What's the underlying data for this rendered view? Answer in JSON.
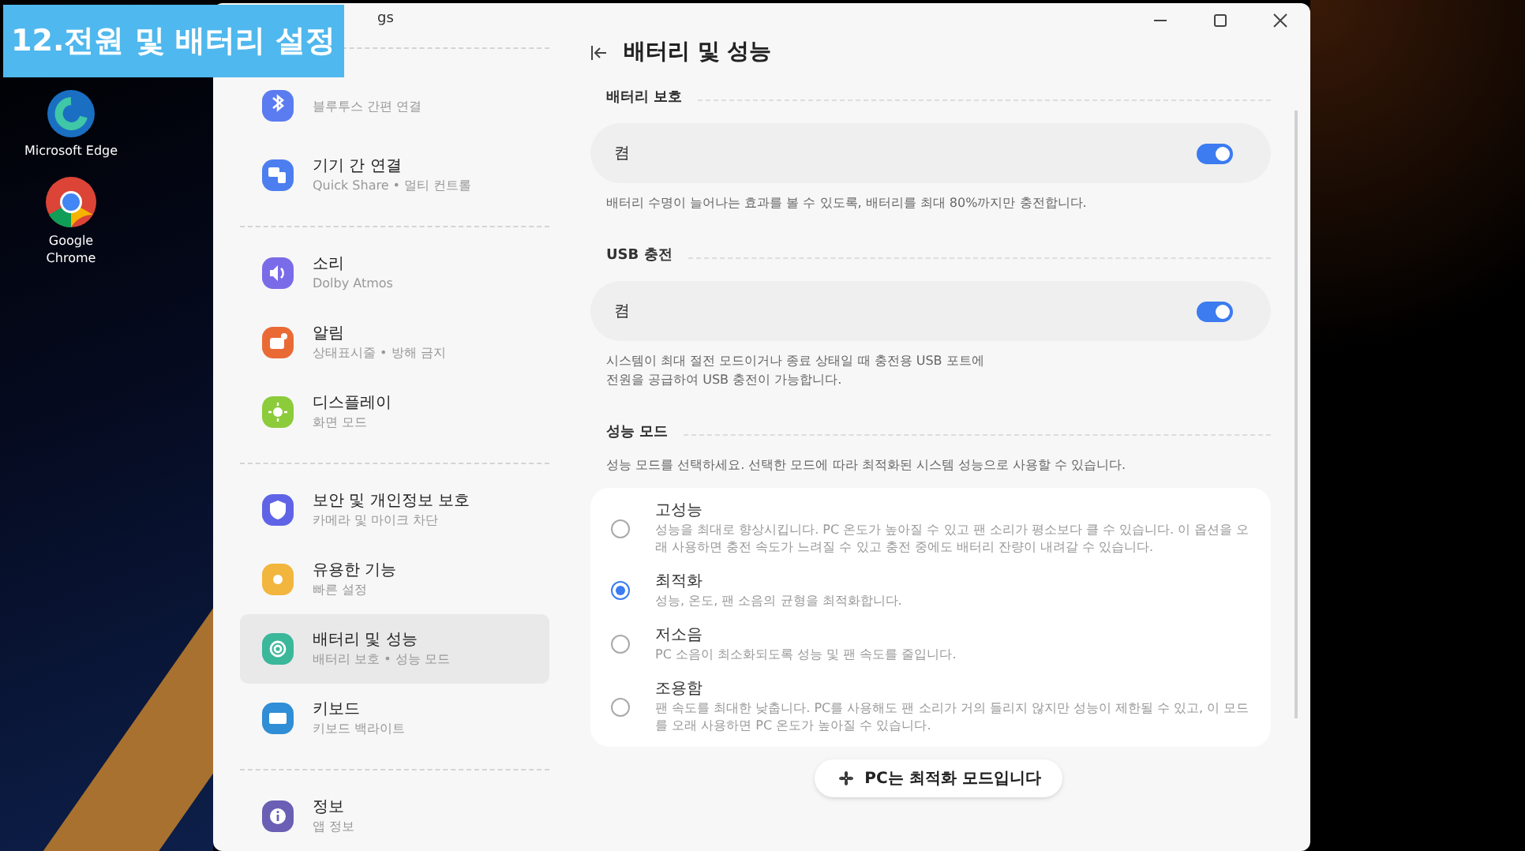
{
  "video_caption": "12.전원 및 배터리 설정",
  "desktop_icons": [
    {
      "kind": "edge",
      "label": "Microsoft Edge"
    },
    {
      "kind": "chrome",
      "label": "Google Chrome"
    }
  ],
  "window": {
    "title": "gs"
  },
  "sidebar": {
    "groups": [
      [
        {
          "kind": "bluetooth",
          "subtitle": "블루투스 간편 연결",
          "color": "#5b7cf0",
          "selected": false
        },
        {
          "kind": "connect",
          "title": "기기 간 연결",
          "subtitle": "Quick Share • 멀티 컨트롤",
          "color": "#4c7ef0",
          "selected": false
        }
      ],
      [
        {
          "kind": "sound",
          "title": "소리",
          "subtitle": "Dolby Atmos",
          "color": "#7a6be8",
          "selected": false
        },
        {
          "kind": "bell",
          "title": "알림",
          "subtitle": "상태표시줄 • 방해 금지",
          "color": "#ea6a36",
          "selected": false
        },
        {
          "kind": "sun",
          "title": "디스플레이",
          "subtitle": "화면 모드",
          "color": "#8ccb3a",
          "selected": false
        }
      ],
      [
        {
          "kind": "shield",
          "title": "보안 및 개인정보 보호",
          "subtitle": "카메라 및 마이크 차단",
          "color": "#5f64e6",
          "selected": false
        },
        {
          "kind": "gear",
          "title": "유용한 기능",
          "subtitle": "빠른 설정",
          "color": "#f2b53d",
          "selected": false
        },
        {
          "kind": "battery",
          "title": "배터리 및 성능",
          "subtitle": "배터리 보호 • 성능 모드",
          "color": "#3bb79a",
          "selected": true
        },
        {
          "kind": "keyboard",
          "title": "키보드",
          "subtitle": "키보드 백라이트",
          "color": "#2f8ed6",
          "selected": false
        }
      ],
      [
        {
          "kind": "info",
          "title": "정보",
          "subtitle": "앱 정보",
          "color": "#6a5fb4",
          "selected": false
        }
      ]
    ]
  },
  "page": {
    "title": "배터리 및 성능"
  },
  "sections": [
    {
      "kind": "toggle",
      "heading": "배터리 보호",
      "toggle": {
        "label": "켬",
        "on": true
      },
      "description": [
        "배터리 수명이 늘어나는 효과를 볼 수 있도록, 배터리를 최대 80%까지만 충전합니다."
      ]
    },
    {
      "kind": "toggle",
      "heading": "USB 충전",
      "toggle": {
        "label": "켬",
        "on": true
      },
      "description": [
        "시스템이 최대 절전 모드이거나 종료 상태일 때 충전용 USB 포트에",
        "전원을 공급하여 USB 충전이 가능합니다."
      ]
    },
    {
      "kind": "options",
      "heading": "성능 모드",
      "description": [
        "성능 모드를 선택하세요. 선택한 모드에 따라 최적화된 시스템 성능으로 사용할 수 있습니다."
      ],
      "options": [
        {
          "title": "고성능",
          "text": "성능을 최대로 향상시킵니다. PC 온도가 높아질 수 있고 팬 소리가 평소보다 클 수 있습니다. 이 옵션을 오래 사용하면 충전 속도가 느려질 수 있고 충전 중에도 배터리 잔량이 내려갈 수 있습니다.",
          "selected": false
        },
        {
          "title": "최적화",
          "text": "성능, 온도, 팬 소음의 균형을 최적화합니다.",
          "selected": true
        },
        {
          "title": "저소음",
          "text": "PC 소음이 최소화되도록 성능 및 팬 속도를 줄입니다.",
          "selected": false
        },
        {
          "title": "조용함",
          "text": "팬 속도를 최대한 낮춥니다. PC를 사용해도 팬 소리가 거의 들리지 않지만 성능이 제한될 수 있고, 이 모드를 오래 사용하면 PC 온도가 높아질 수 있습니다.",
          "selected": false
        }
      ]
    }
  ],
  "toast": {
    "text": "PC는 최적화 모드입니다"
  }
}
